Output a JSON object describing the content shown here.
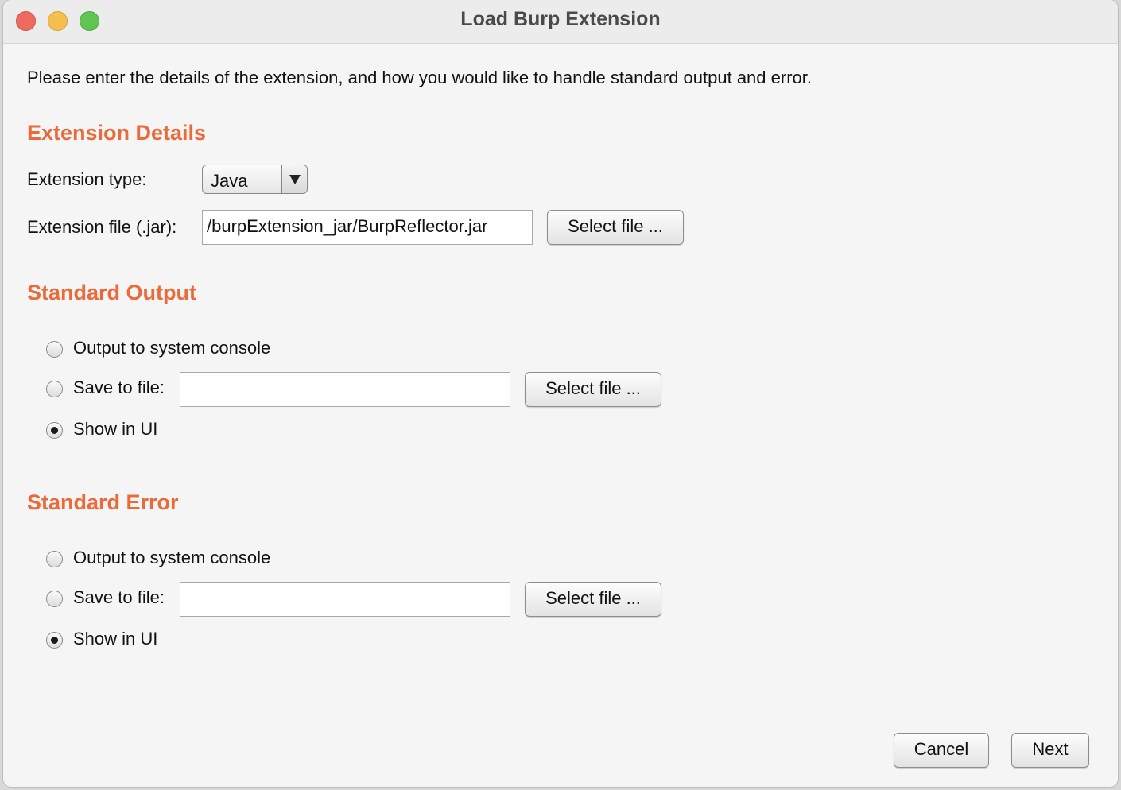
{
  "window": {
    "title": "Load Burp Extension"
  },
  "intro_text": "Please enter the details of the extension, and how you would like to handle standard output and error.",
  "extension_details": {
    "heading": "Extension Details",
    "type_label": "Extension type:",
    "type_value": "Java",
    "file_label": "Extension file (.jar):",
    "file_value": "/burpExtension_jar/BurpReflector.jar",
    "select_file_label": "Select file ..."
  },
  "standard_output": {
    "heading": "Standard Output",
    "options": [
      {
        "label": "Output to system console",
        "selected": false
      },
      {
        "label": "Save to file:",
        "selected": false
      },
      {
        "label": "Show in UI",
        "selected": true
      }
    ],
    "file_value": "",
    "select_file_label": "Select file ..."
  },
  "standard_error": {
    "heading": "Standard Error",
    "options": [
      {
        "label": "Output to system console",
        "selected": false
      },
      {
        "label": "Save to file:",
        "selected": false
      },
      {
        "label": "Show in UI",
        "selected": true
      }
    ],
    "file_value": "",
    "select_file_label": "Select file ..."
  },
  "footer": {
    "cancel_label": "Cancel",
    "next_label": "Next"
  },
  "colors": {
    "section_heading": "#ec6a3a",
    "close": "#ee6a5f",
    "minimize": "#f5bf4f",
    "maximize": "#61c554"
  },
  "icons": {
    "combo_arrow": "triangle-down-icon"
  }
}
